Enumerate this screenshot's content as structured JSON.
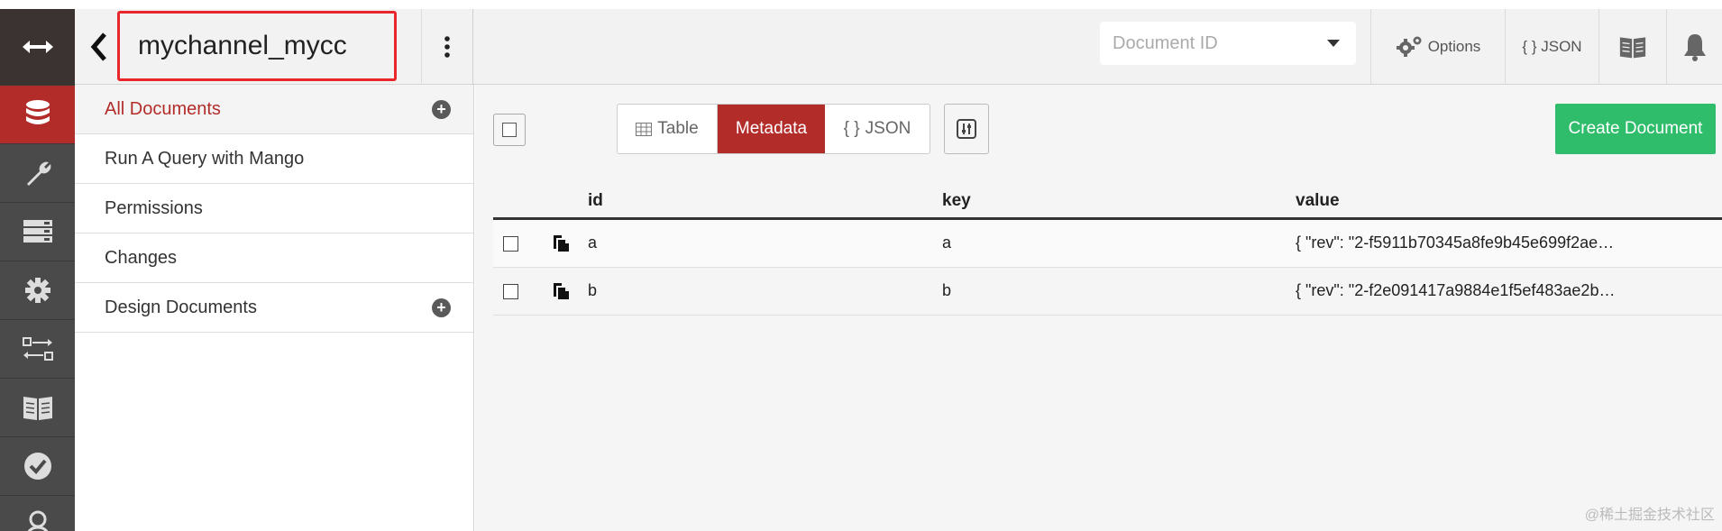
{
  "header": {
    "db_title": "mychannel_mycc",
    "doc_id_placeholder": "Document ID",
    "options_label": "Options",
    "json_label": "{ } JSON"
  },
  "sidebar": {
    "items": [
      {
        "label": "All Documents"
      },
      {
        "label": "Run A Query with Mango"
      },
      {
        "label": "Permissions"
      },
      {
        "label": "Changes"
      },
      {
        "label": "Design Documents"
      }
    ]
  },
  "toolbar": {
    "view_table": "Table",
    "view_metadata": "Metadata",
    "view_json": "JSON",
    "create_document": "Create Document"
  },
  "grid": {
    "columns": [
      "id",
      "key",
      "value"
    ],
    "rows": [
      {
        "id": "a",
        "key": "a",
        "value": "{ \"rev\": \"2-f5911b70345a8fe9b45e699f2ae…"
      },
      {
        "id": "b",
        "key": "b",
        "value": "{ \"rev\": \"2-f2e091417a9884e1f5ef483ae2b…"
      }
    ]
  },
  "watermark": "@稀土掘金技术社区",
  "colors": {
    "accent": "#b22c2a",
    "create": "#2fbd6b",
    "highlight_box": "#e8262b"
  }
}
